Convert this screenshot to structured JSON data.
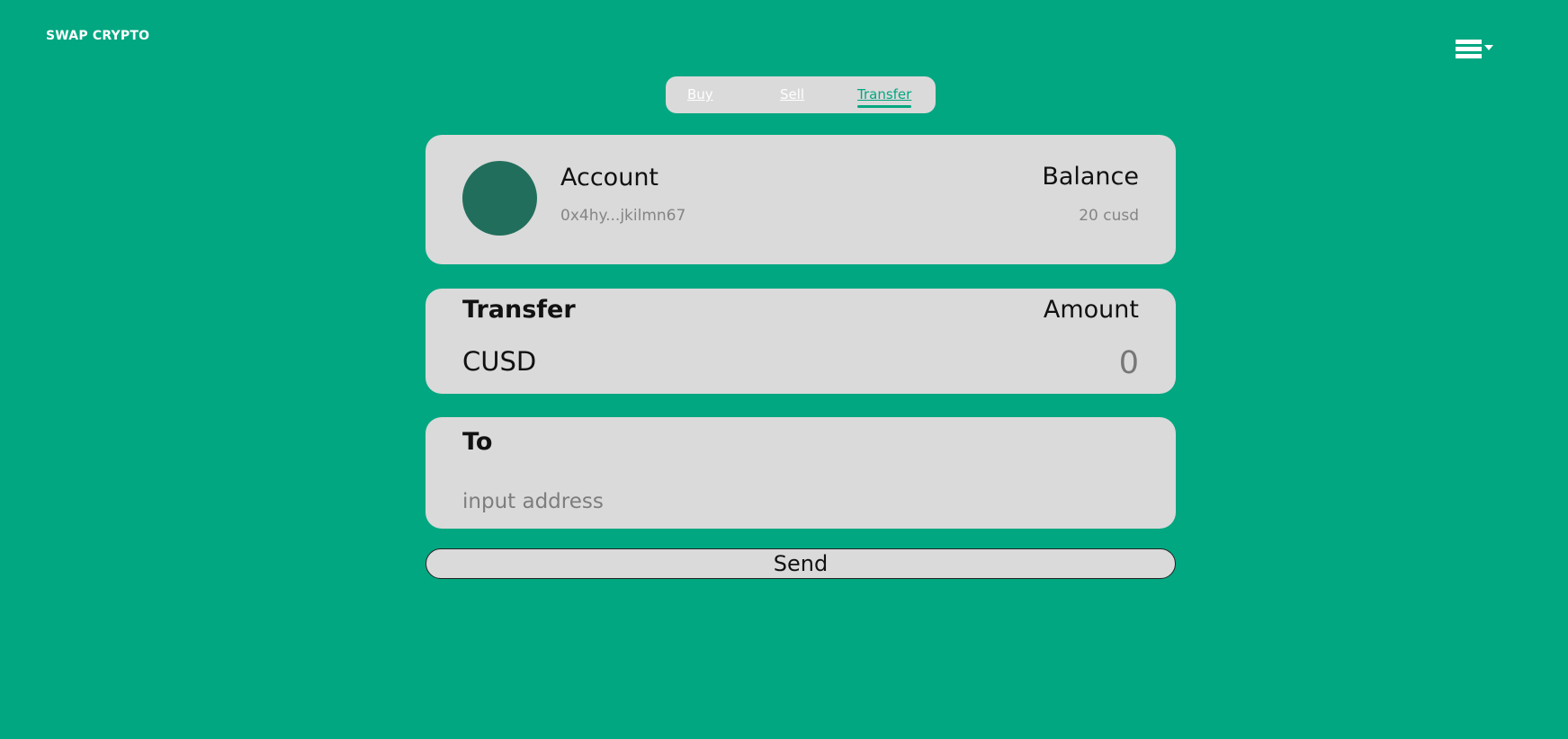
{
  "header": {
    "brand": "SWAP CRYPTO",
    "menu_icon": "hamburger-dropdown-icon"
  },
  "tabs": [
    {
      "label": "Buy",
      "active": false
    },
    {
      "label": "Sell",
      "active": false
    },
    {
      "label": "Transfer",
      "active": true
    }
  ],
  "account": {
    "label": "Account",
    "address": "0x4hy...jkilmn67",
    "balance_label": "Balance",
    "balance_value": "20 cusd"
  },
  "transfer": {
    "label": "Transfer",
    "currency": "CUSD",
    "amount_label": "Amount",
    "amount_value": "0"
  },
  "recipient": {
    "label": "To",
    "placeholder": "input address",
    "value": ""
  },
  "send_label": "Send",
  "colors": {
    "background": "#01a781",
    "card": "#dadada",
    "avatar": "#216e5c",
    "accent": "#01a781"
  }
}
